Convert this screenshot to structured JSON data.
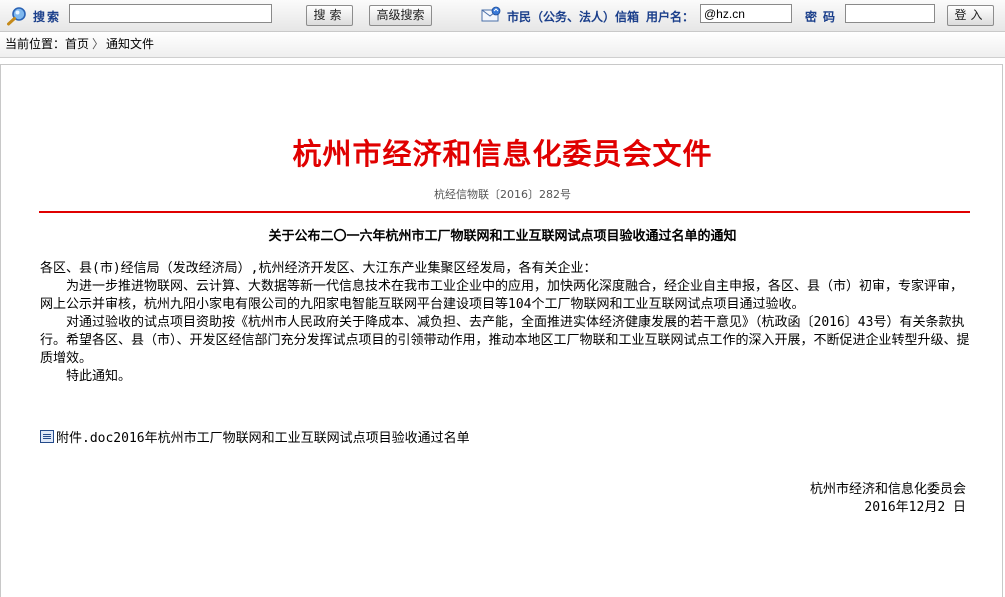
{
  "toolbar": {
    "search_label": "搜索",
    "search_value": "",
    "search_button": "搜索",
    "advanced_button": "高级搜索",
    "mailbox_label": "市民（公务、法人）信箱",
    "username_label": "用户名：",
    "username_value": "@hz.cn",
    "password_label": "密码",
    "login_button": "登入"
  },
  "breadcrumb": {
    "prefix": "当前位置：",
    "home": "首页",
    "separator": "〉",
    "current": "通知文件"
  },
  "document": {
    "header_title": "杭州市经济和信息化委员会文件",
    "doc_number": "杭经信物联〔2016〕282号",
    "notice_title": "关于公布二〇一六年杭州市工厂物联网和工业互联网试点项目验收通过名单的通知",
    "salutation": "各区、县(市)经信局（发改经济局）,杭州经济开发区、大江东产业集聚区经发局，各有关企业：",
    "paragraphs": [
      "为进一步推进物联网、云计算、大数据等新一代信息技术在我市工业企业中的应用，加快两化深度融合，经企业自主申报，各区、县（市）初审，专家评审，网上公示并审核，杭州九阳小家电有限公司的九阳家电智能互联网平台建设项目等104个工厂物联网和工业互联网试点项目通过验收。",
      "对通过验收的试点项目资助按《杭州市人民政府关于降成本、减负担、去产能，全面推进实体经济健康发展的若干意见》（杭政函〔2016〕43号）有关条款执行。希望各区、县（市）、开发区经信部门充分发挥试点项目的引领带动作用，推动本地区工厂物联和工业互联网试点工作的深入开展，不断促进企业转型升级、提质增效。",
      "特此通知。"
    ],
    "attachment": "附件.doc2016年杭州市工厂物联网和工业互联网试点项目验收通过名单",
    "signature_org": "杭州市经济和信息化委员会",
    "signature_date": "2016年12月2 日"
  },
  "colors": {
    "accent_red": "#e00000",
    "toolbar_blue": "#1b3f8b"
  }
}
